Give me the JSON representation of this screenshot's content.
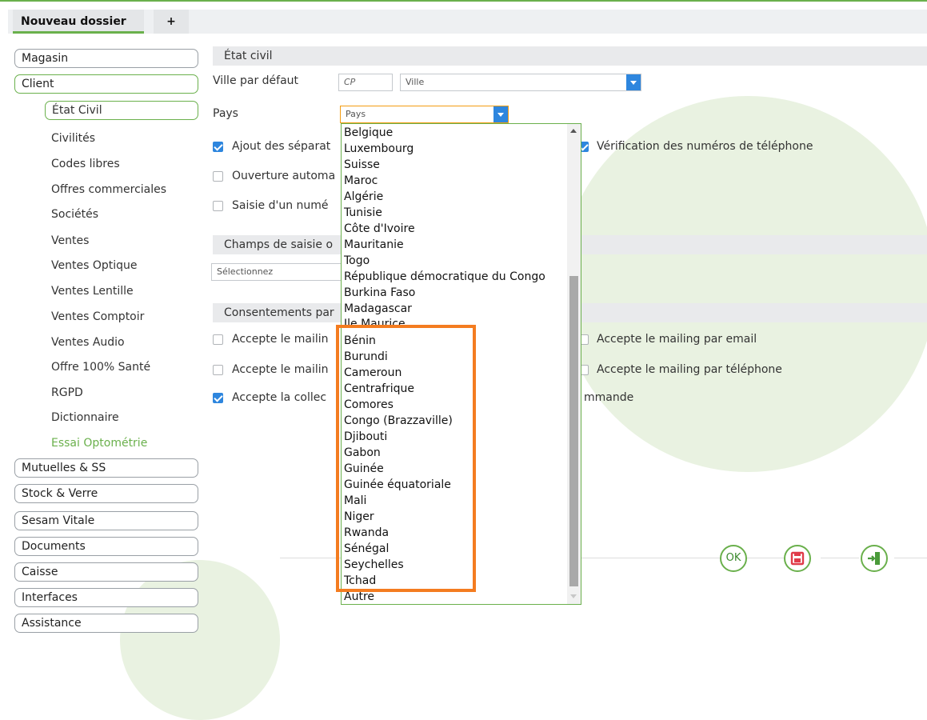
{
  "tabs": {
    "active_label": "Nouveau dossier",
    "add_label": "+"
  },
  "sidebar": {
    "groups_top": [
      {
        "label": "Magasin"
      },
      {
        "label": "Client"
      }
    ],
    "subitems": [
      {
        "label": "État Civil"
      },
      {
        "label": "Civilités"
      },
      {
        "label": "Codes libres"
      },
      {
        "label": "Offres commerciales"
      },
      {
        "label": "Sociétés"
      },
      {
        "label": "Ventes"
      },
      {
        "label": "Ventes Optique"
      },
      {
        "label": "Ventes Lentille"
      },
      {
        "label": "Ventes Comptoir"
      },
      {
        "label": "Ventes Audio"
      },
      {
        "label": "Offre 100% Santé"
      },
      {
        "label": "RGPD"
      },
      {
        "label": "Dictionnaire"
      },
      {
        "label": "Essai Optométrie"
      }
    ],
    "groups_bottom": [
      {
        "label": "Mutuelles & SS"
      },
      {
        "label": "Stock & Verre"
      },
      {
        "label": "Sesam Vitale"
      },
      {
        "label": "Documents"
      },
      {
        "label": "Caisse"
      },
      {
        "label": "Interfaces"
      },
      {
        "label": "Assistance"
      }
    ]
  },
  "etat_civil": {
    "title": "État civil",
    "ville_label": "Ville par défaut",
    "cp_placeholder": "CP",
    "ville_placeholder": "Ville",
    "pays_label": "Pays",
    "pays_value": "Pays",
    "cb_ajout": "Ajout des séparat",
    "cb_verif": "Vérification des numéros de téléphone",
    "cb_ouverture": "Ouverture automa",
    "cb_saisie": "Saisie d'un numé"
  },
  "champs": {
    "title": "Champs de saisie o",
    "select_value": "Sélectionnez"
  },
  "consentements": {
    "title": "Consentements par",
    "mailing1": "Accepte le mailin",
    "mailing_email": "Accepte le mailing par email",
    "mailing2": "Accepte le mailin",
    "mailing_tel": "Accepte le mailing par téléphone",
    "collecte": "Accepte la collec",
    "commande": "mmande"
  },
  "dropdown": {
    "items": [
      "Belgique",
      "Luxembourg",
      "Suisse",
      "Maroc",
      "Algérie",
      "Tunisie",
      "Côte d'Ivoire",
      "Mauritanie",
      "Togo",
      "République démocratique du Congo",
      "Burkina Faso",
      "Madagascar",
      "Ile Maurice",
      "Bénin",
      "Burundi",
      "Cameroun",
      "Centrafrique",
      "Comores",
      "Congo (Brazzaville)",
      "Djibouti",
      "Gabon",
      "Guinée",
      "Guinée équatoriale",
      "Mali",
      "Niger",
      "Rwanda",
      "Sénégal",
      "Seychelles",
      "Tchad",
      "Autre"
    ]
  },
  "actions": {
    "ok_label": "OK"
  },
  "colors": {
    "accent": "#6ab04c",
    "highlight": "#f47c20",
    "select_button": "#2e86de"
  }
}
